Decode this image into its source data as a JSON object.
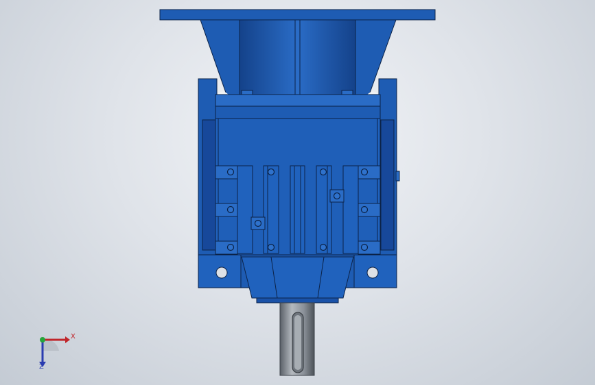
{
  "viewport": {
    "background": "#dfe3e9",
    "part_color": "#1f5fb8",
    "part_dark": "#143f80",
    "part_light": "#3f7fd4",
    "shaft_color": "#8e949c"
  },
  "triad": {
    "x_label": "X",
    "z_label": "Z",
    "x_color": "#c0262b",
    "y_color": "#27a53a",
    "z_color": "#2a3cb0"
  }
}
